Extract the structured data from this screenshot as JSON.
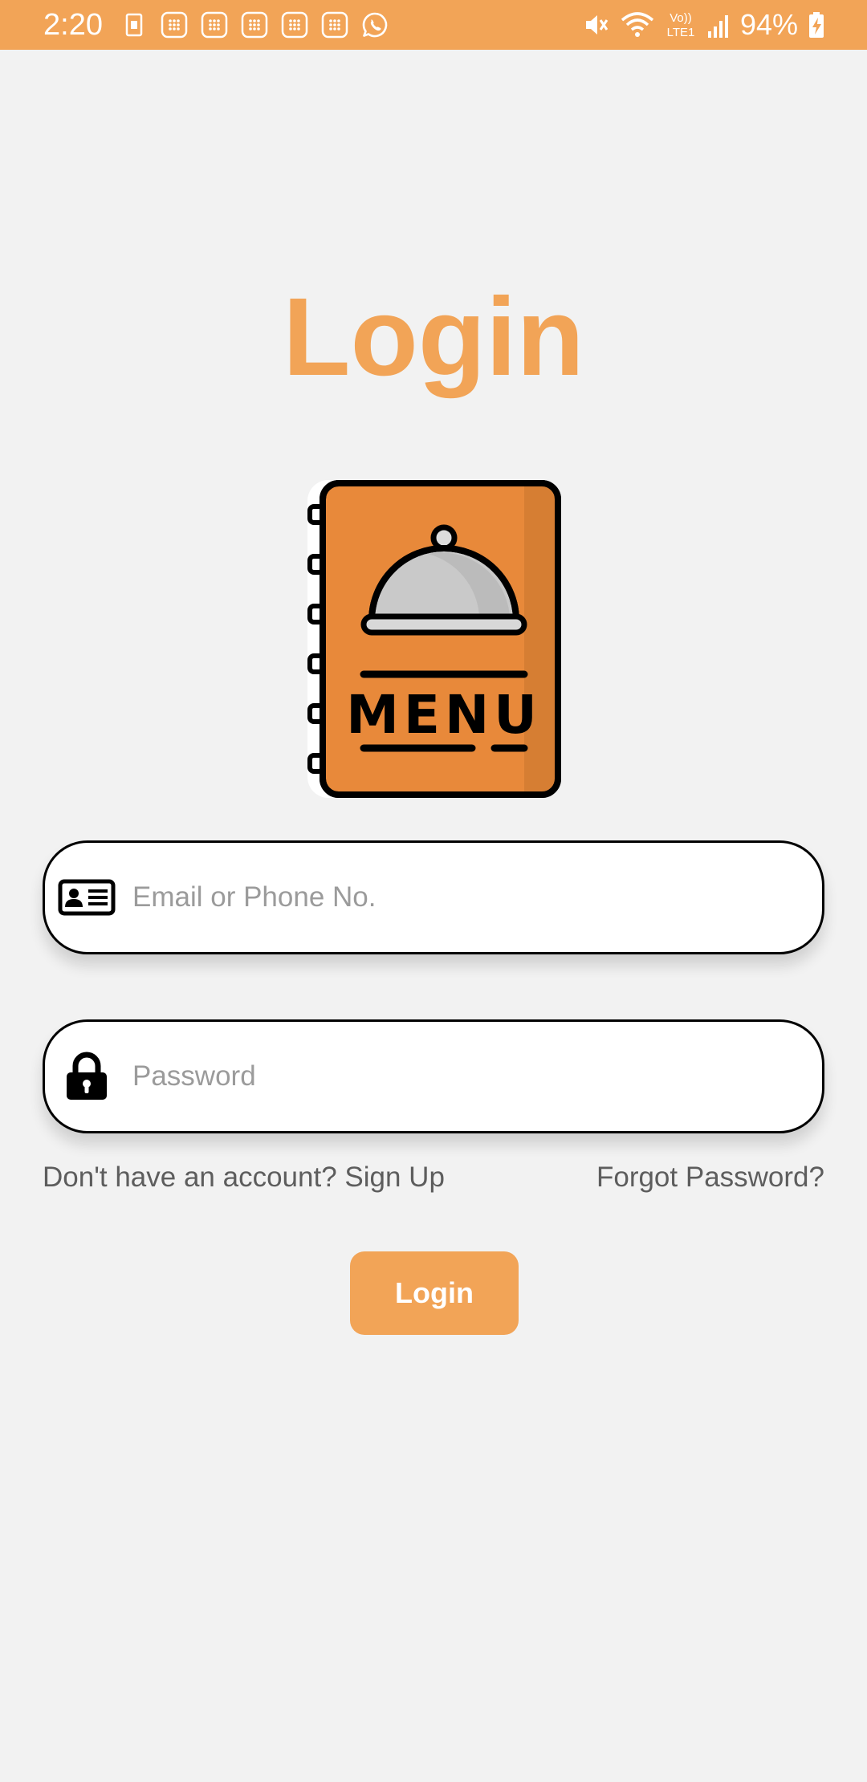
{
  "status_bar": {
    "time": "2:20",
    "battery_percent": "94%",
    "network_label_top": "Vo))",
    "network_label_bottom": "LTE1",
    "background_color": "#f2a457",
    "icons": [
      "sim-card-icon",
      "notification-icon",
      "notification-icon",
      "notification-icon",
      "notification-icon",
      "notification-icon",
      "whatsapp-icon",
      "mute-icon",
      "wifi-icon",
      "volte-icon",
      "signal-icon",
      "battery-charging-icon"
    ]
  },
  "page": {
    "title": "Login",
    "accent_color": "#f2a457",
    "background_color": "#f2f2f2"
  },
  "logo": {
    "icon": "menu-book-icon",
    "text": "MENU"
  },
  "form": {
    "email": {
      "placeholder": "Email or Phone No.",
      "value": "",
      "icon": "id-card-icon"
    },
    "password": {
      "placeholder": "Password",
      "value": "",
      "icon": "lock-icon"
    },
    "signup_link": "Don't have an account? Sign Up",
    "forgot_link": "Forgot Password?",
    "submit_label": "Login"
  }
}
